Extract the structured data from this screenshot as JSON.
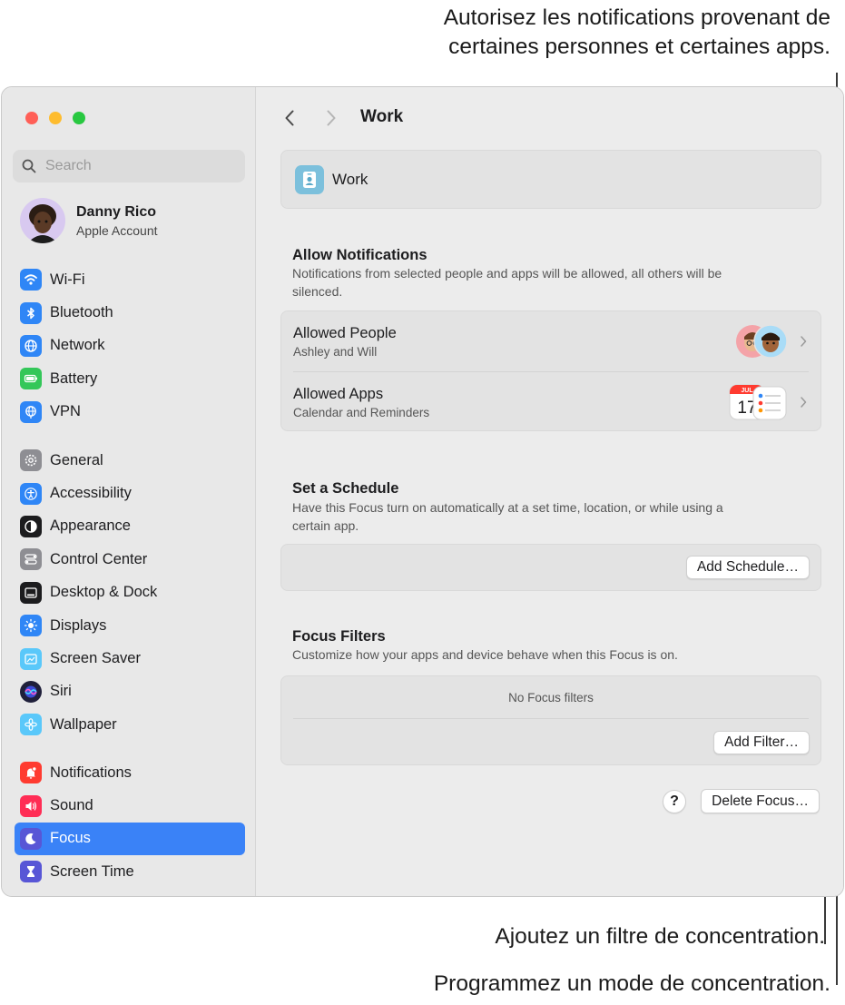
{
  "callouts": {
    "top_line1": "Autorisez les notifications provenant de",
    "top_line2": "certaines personnes et certaines apps.",
    "filter": "Ajoutez un filtre de concentration.",
    "schedule": "Programmez un mode de concentration."
  },
  "sidebar": {
    "search_placeholder": "Search",
    "account": {
      "name": "Danny Rico",
      "subtitle": "Apple Account"
    },
    "group1": [
      {
        "label": "Wi-Fi",
        "icon": "wifi-icon",
        "color": "#2f86f6"
      },
      {
        "label": "Bluetooth",
        "icon": "bluetooth-icon",
        "color": "#2f86f6"
      },
      {
        "label": "Network",
        "icon": "globe-icon",
        "color": "#2f86f6"
      },
      {
        "label": "Battery",
        "icon": "battery-icon",
        "color": "#34c759"
      },
      {
        "label": "VPN",
        "icon": "vpn-globe-icon",
        "color": "#2f86f6"
      }
    ],
    "group2": [
      {
        "label": "General",
        "icon": "gear-icon",
        "color": "#8e8e93"
      },
      {
        "label": "Accessibility",
        "icon": "accessibility-icon",
        "color": "#2f86f6"
      },
      {
        "label": "Appearance",
        "icon": "appearance-icon",
        "color": "#1c1c1e"
      },
      {
        "label": "Control Center",
        "icon": "control-center-icon",
        "color": "#8e8e93"
      },
      {
        "label": "Desktop & Dock",
        "icon": "dock-icon",
        "color": "#1c1c1e"
      },
      {
        "label": "Displays",
        "icon": "sun-icon",
        "color": "#2f86f6"
      },
      {
        "label": "Screen Saver",
        "icon": "screen-saver-icon",
        "color": "#5ac8fa"
      },
      {
        "label": "Siri",
        "icon": "siri-icon",
        "color": "#3a3a6a"
      },
      {
        "label": "Wallpaper",
        "icon": "flower-icon",
        "color": "#5ac8fa"
      }
    ],
    "group3": [
      {
        "label": "Notifications",
        "icon": "bell-icon",
        "color": "#ff3b30"
      },
      {
        "label": "Sound",
        "icon": "speaker-icon",
        "color": "#ff2d55"
      },
      {
        "label": "Focus",
        "icon": "moon-icon",
        "color": "#5856d6",
        "selected": true
      },
      {
        "label": "Screen Time",
        "icon": "hourglass-icon",
        "color": "#5856d6"
      }
    ]
  },
  "main": {
    "title": "Work",
    "focus_name": "Work",
    "allow": {
      "title": "Allow Notifications",
      "desc": "Notifications from selected people and apps will be allowed, all others will be silenced.",
      "people_title": "Allowed People",
      "people_sub": "Ashley and Will",
      "apps_title": "Allowed Apps",
      "apps_sub": "Calendar and Reminders",
      "calendar_month": "JUL",
      "calendar_day": "17"
    },
    "schedule": {
      "title": "Set a Schedule",
      "desc": "Have this Focus turn on automatically at a set time, location, or while using a certain app.",
      "button": "Add Schedule…"
    },
    "filters": {
      "title": "Focus Filters",
      "desc": "Customize how your apps and device behave when this Focus is on.",
      "empty": "No Focus filters",
      "button": "Add Filter…"
    },
    "help": "?",
    "delete_button": "Delete Focus…"
  }
}
